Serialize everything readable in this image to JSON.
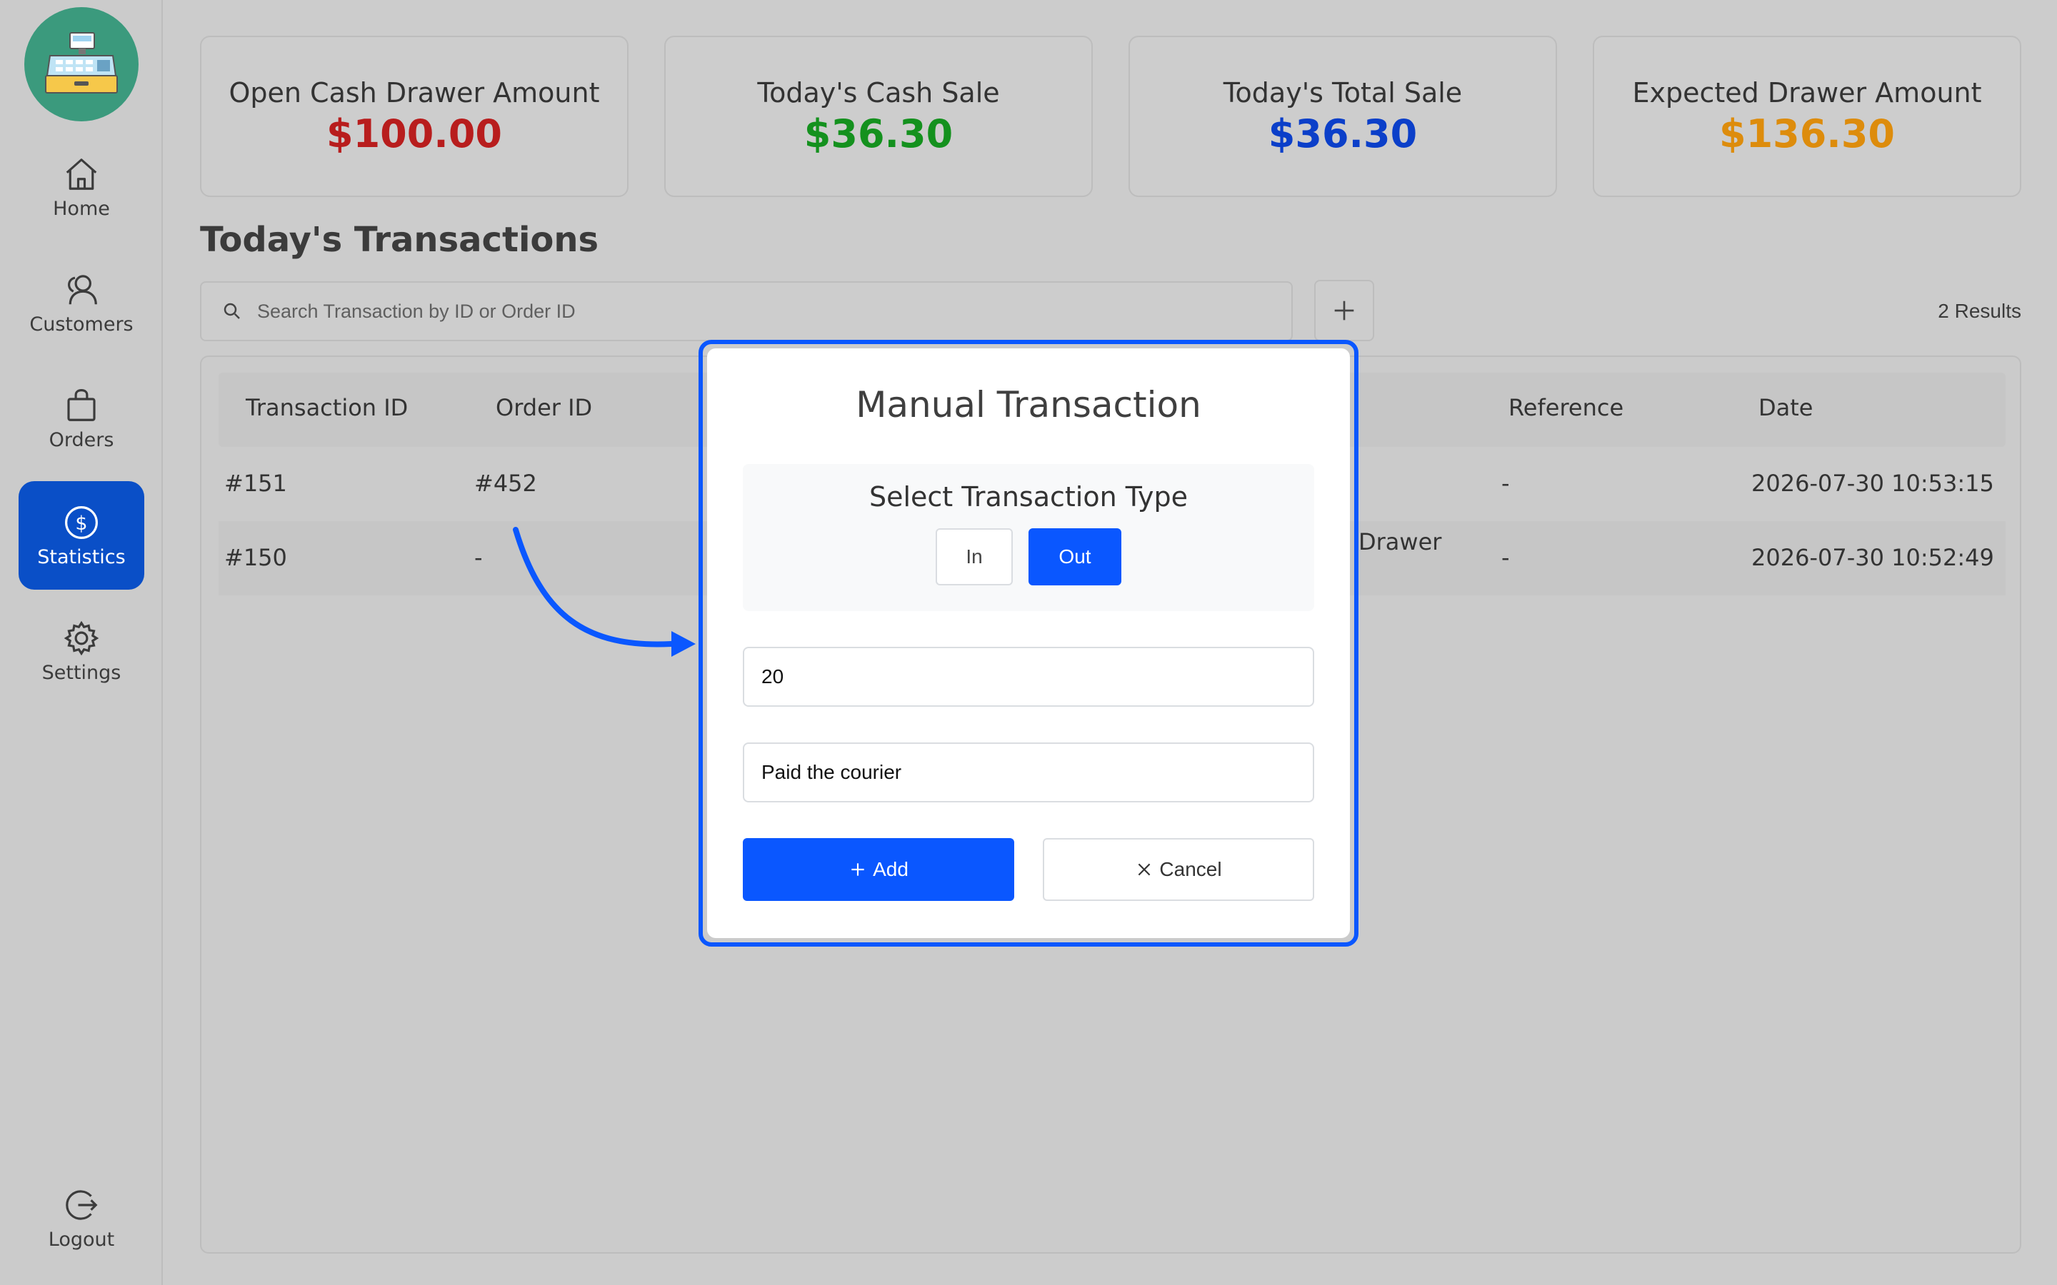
{
  "sidebar": {
    "logo_icon": "cash-register-icon",
    "items": [
      {
        "label": "Home",
        "icon": "home-icon"
      },
      {
        "label": "Customers",
        "icon": "customers-icon"
      },
      {
        "label": "Orders",
        "icon": "shopping-bag-icon"
      },
      {
        "label": "Statistics",
        "icon": "dollar-circle-icon",
        "active": true
      },
      {
        "label": "Settings",
        "icon": "gear-icon"
      }
    ],
    "logout_label": "Logout"
  },
  "stats": [
    {
      "label": "Open Cash Drawer Amount",
      "value": "$100.00",
      "color": "#b81d1d"
    },
    {
      "label": "Today's Cash Sale",
      "value": "$36.30",
      "color": "#14911e"
    },
    {
      "label": "Today's Total Sale",
      "value": "$36.30",
      "color": "#0b3fc9"
    },
    {
      "label": "Expected Drawer Amount",
      "value": "$136.30",
      "color": "#dd8c0c"
    }
  ],
  "transactions": {
    "title": "Today's Transactions",
    "search_placeholder": "Search Transaction by ID or Order ID",
    "results": "2 Results",
    "columns": {
      "transaction_id": "Transaction ID",
      "order_id": "Order ID",
      "reference": "Reference",
      "date": "Date"
    },
    "rows": [
      {
        "id": "#151",
        "order": "#452",
        "note": "",
        "reference": "-",
        "date": "2026-07-30 10:53:15"
      },
      {
        "id": "#150",
        "order": "-",
        "note": "Drawer",
        "reference": "-",
        "date": "2026-07-30 10:52:49"
      }
    ]
  },
  "modal": {
    "title": "Manual Transaction",
    "type_label": "Select Transaction Type",
    "type_in": "In",
    "type_out": "Out",
    "selected_type": "Out",
    "amount_value": "20",
    "note_value": "Paid the courier",
    "add_label": "Add",
    "cancel_label": "Cancel"
  },
  "colors": {
    "accent": "#0a57ff",
    "sidebar_active": "#0a4fc7"
  }
}
